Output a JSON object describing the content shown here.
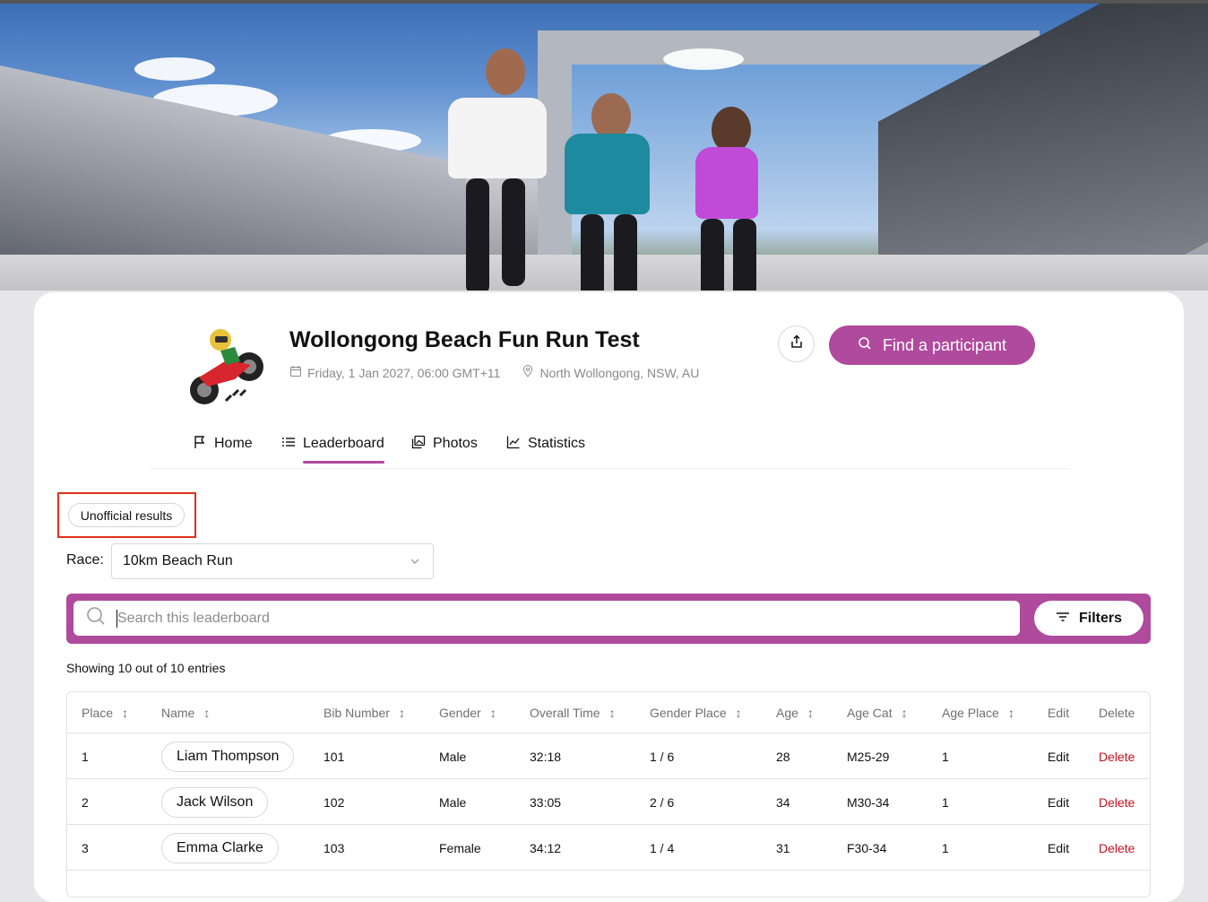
{
  "event": {
    "title": "Wollongong Beach Fun Run Test",
    "date": "Friday, 1 Jan 2027, 06:00 GMT+11",
    "location": "North Wollongong, NSW, AU",
    "find_label": "Find a participant"
  },
  "tabs": [
    {
      "label": "Home",
      "icon": "flag-icon"
    },
    {
      "label": "Leaderboard",
      "icon": "list-icon",
      "active": true
    },
    {
      "label": "Photos",
      "icon": "photos-icon"
    },
    {
      "label": "Statistics",
      "icon": "chart-icon"
    }
  ],
  "status_badge": "Unofficial results",
  "race": {
    "label": "Race:",
    "selected": "10km Beach Run"
  },
  "search": {
    "placeholder": "Search this leaderboard",
    "filters_label": "Filters"
  },
  "showing": "Showing 10 out of 10 entries",
  "table": {
    "headers": [
      "Place",
      "Name",
      "Bib Number",
      "Gender",
      "Overall Time",
      "Gender Place",
      "Age",
      "Age Cat",
      "Age Place",
      "Edit",
      "Delete"
    ],
    "rows": [
      {
        "place": "1",
        "name": "Liam Thompson",
        "bib": "101",
        "gender": "Male",
        "time": "32:18",
        "gender_place": "1 / 6",
        "age": "28",
        "age_cat": "M25-29",
        "age_place": "1",
        "edit": "Edit",
        "delete": "Delete"
      },
      {
        "place": "2",
        "name": "Jack Wilson",
        "bib": "102",
        "gender": "Male",
        "time": "33:05",
        "gender_place": "2 / 6",
        "age": "34",
        "age_cat": "M30-34",
        "age_place": "1",
        "edit": "Edit",
        "delete": "Delete"
      },
      {
        "place": "3",
        "name": "Emma Clarke",
        "bib": "103",
        "gender": "Female",
        "time": "34:12",
        "gender_place": "1 / 4",
        "age": "31",
        "age_cat": "F30-34",
        "age_place": "1",
        "edit": "Edit",
        "delete": "Delete"
      }
    ]
  },
  "colors": {
    "accent": "#b04a9d",
    "danger": "#c2121f",
    "highlight": "#e0321c"
  }
}
